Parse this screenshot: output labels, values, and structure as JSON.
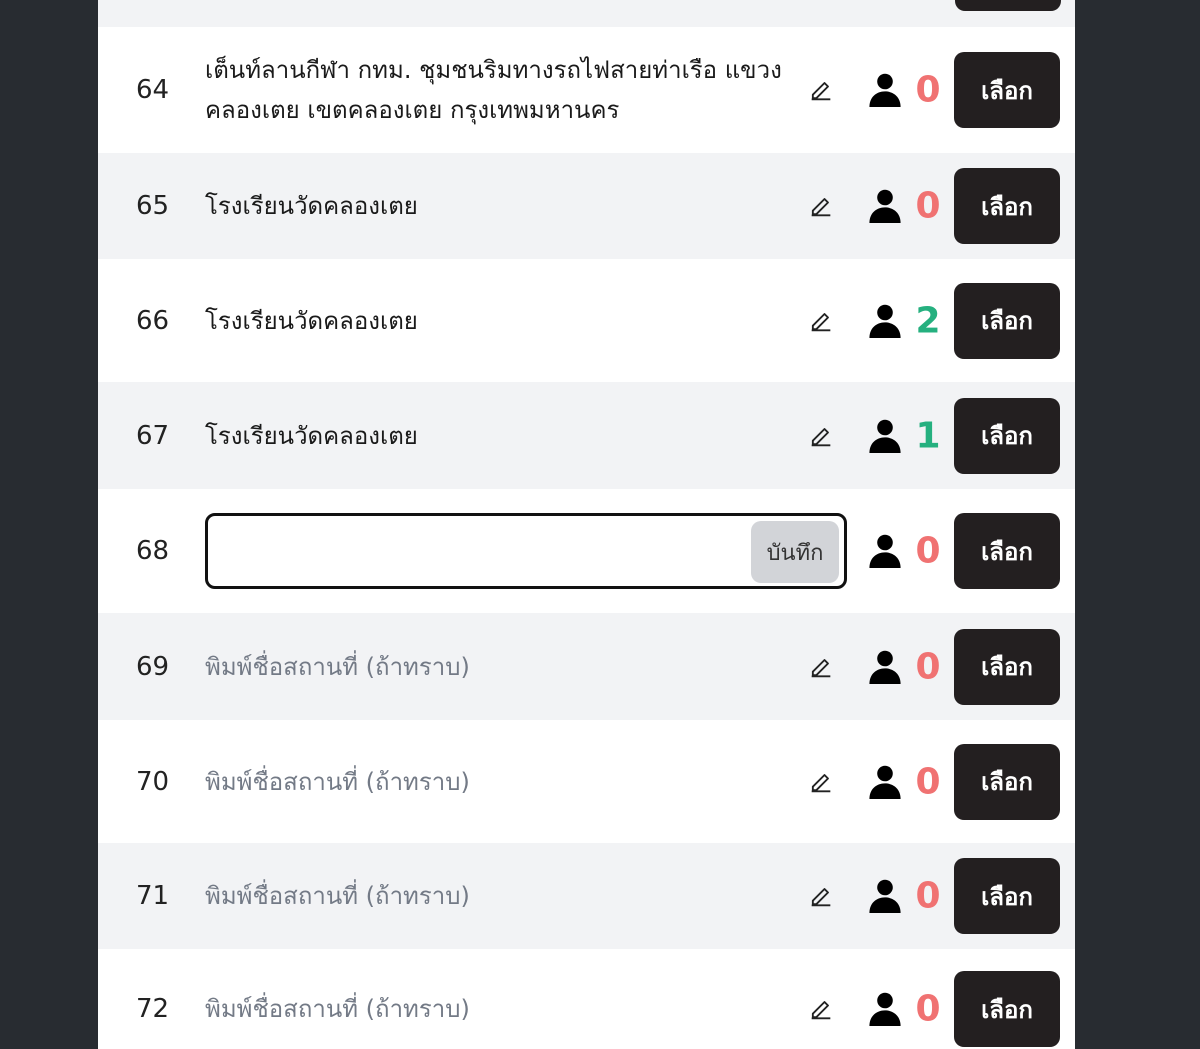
{
  "rows": [
    {
      "number": "64",
      "name": "เต็นท์ลานกีฬา กทม. ชุมชนริมทางรถไฟสายท่าเรือ แขวงคลองเตย เขตคลองเตย กรุงเทพมหานคร",
      "count": "0",
      "select_label": "เลือก"
    },
    {
      "number": "65",
      "name": "โรงเรียนวัดคลองเตย",
      "count": "0",
      "select_label": "เลือก"
    },
    {
      "number": "66",
      "name": "โรงเรียนวัดคลองเตย",
      "count": "2",
      "select_label": "เลือก"
    },
    {
      "number": "67",
      "name": "โรงเรียนวัดคลองเตย",
      "count": "1",
      "select_label": "เลือก"
    },
    {
      "number": "68",
      "input_value": "",
      "save_label": "บันทึก",
      "count": "0",
      "select_label": "เลือก"
    },
    {
      "number": "69",
      "placeholder": "พิมพ์ชื่อสถานที่ (ถ้าทราบ)",
      "count": "0",
      "select_label": "เลือก"
    },
    {
      "number": "70",
      "placeholder": "พิมพ์ชื่อสถานที่ (ถ้าทราบ)",
      "count": "0",
      "select_label": "เลือก"
    },
    {
      "number": "71",
      "placeholder": "พิมพ์ชื่อสถานที่ (ถ้าทราบ)",
      "count": "0",
      "select_label": "เลือก"
    },
    {
      "number": "72",
      "placeholder": "พิมพ์ชื่อสถานที่ (ถ้าทราบ)",
      "count": "0",
      "select_label": "เลือก"
    }
  ],
  "icons": {
    "edit": "pencil-icon",
    "people": "person-icon"
  },
  "colors": {
    "count_zero": "#f07272",
    "count_positive": "#25b07f",
    "button_bg": "#231f20"
  }
}
